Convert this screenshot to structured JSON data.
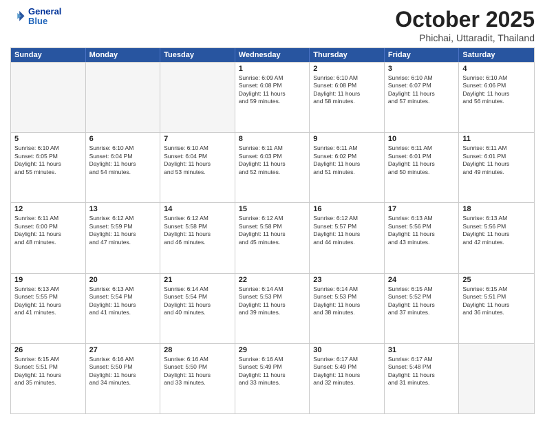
{
  "logo": {
    "line1": "General",
    "line2": "Blue"
  },
  "title": "October 2025",
  "subtitle": "Phichai, Uttaradit, Thailand",
  "header_days": [
    "Sunday",
    "Monday",
    "Tuesday",
    "Wednesday",
    "Thursday",
    "Friday",
    "Saturday"
  ],
  "weeks": [
    [
      {
        "day": "",
        "info": ""
      },
      {
        "day": "",
        "info": ""
      },
      {
        "day": "",
        "info": ""
      },
      {
        "day": "1",
        "info": "Sunrise: 6:09 AM\nSunset: 6:08 PM\nDaylight: 11 hours\nand 59 minutes."
      },
      {
        "day": "2",
        "info": "Sunrise: 6:10 AM\nSunset: 6:08 PM\nDaylight: 11 hours\nand 58 minutes."
      },
      {
        "day": "3",
        "info": "Sunrise: 6:10 AM\nSunset: 6:07 PM\nDaylight: 11 hours\nand 57 minutes."
      },
      {
        "day": "4",
        "info": "Sunrise: 6:10 AM\nSunset: 6:06 PM\nDaylight: 11 hours\nand 56 minutes."
      }
    ],
    [
      {
        "day": "5",
        "info": "Sunrise: 6:10 AM\nSunset: 6:05 PM\nDaylight: 11 hours\nand 55 minutes."
      },
      {
        "day": "6",
        "info": "Sunrise: 6:10 AM\nSunset: 6:04 PM\nDaylight: 11 hours\nand 54 minutes."
      },
      {
        "day": "7",
        "info": "Sunrise: 6:10 AM\nSunset: 6:04 PM\nDaylight: 11 hours\nand 53 minutes."
      },
      {
        "day": "8",
        "info": "Sunrise: 6:11 AM\nSunset: 6:03 PM\nDaylight: 11 hours\nand 52 minutes."
      },
      {
        "day": "9",
        "info": "Sunrise: 6:11 AM\nSunset: 6:02 PM\nDaylight: 11 hours\nand 51 minutes."
      },
      {
        "day": "10",
        "info": "Sunrise: 6:11 AM\nSunset: 6:01 PM\nDaylight: 11 hours\nand 50 minutes."
      },
      {
        "day": "11",
        "info": "Sunrise: 6:11 AM\nSunset: 6:01 PM\nDaylight: 11 hours\nand 49 minutes."
      }
    ],
    [
      {
        "day": "12",
        "info": "Sunrise: 6:11 AM\nSunset: 6:00 PM\nDaylight: 11 hours\nand 48 minutes."
      },
      {
        "day": "13",
        "info": "Sunrise: 6:12 AM\nSunset: 5:59 PM\nDaylight: 11 hours\nand 47 minutes."
      },
      {
        "day": "14",
        "info": "Sunrise: 6:12 AM\nSunset: 5:58 PM\nDaylight: 11 hours\nand 46 minutes."
      },
      {
        "day": "15",
        "info": "Sunrise: 6:12 AM\nSunset: 5:58 PM\nDaylight: 11 hours\nand 45 minutes."
      },
      {
        "day": "16",
        "info": "Sunrise: 6:12 AM\nSunset: 5:57 PM\nDaylight: 11 hours\nand 44 minutes."
      },
      {
        "day": "17",
        "info": "Sunrise: 6:13 AM\nSunset: 5:56 PM\nDaylight: 11 hours\nand 43 minutes."
      },
      {
        "day": "18",
        "info": "Sunrise: 6:13 AM\nSunset: 5:56 PM\nDaylight: 11 hours\nand 42 minutes."
      }
    ],
    [
      {
        "day": "19",
        "info": "Sunrise: 6:13 AM\nSunset: 5:55 PM\nDaylight: 11 hours\nand 41 minutes."
      },
      {
        "day": "20",
        "info": "Sunrise: 6:13 AM\nSunset: 5:54 PM\nDaylight: 11 hours\nand 41 minutes."
      },
      {
        "day": "21",
        "info": "Sunrise: 6:14 AM\nSunset: 5:54 PM\nDaylight: 11 hours\nand 40 minutes."
      },
      {
        "day": "22",
        "info": "Sunrise: 6:14 AM\nSunset: 5:53 PM\nDaylight: 11 hours\nand 39 minutes."
      },
      {
        "day": "23",
        "info": "Sunrise: 6:14 AM\nSunset: 5:53 PM\nDaylight: 11 hours\nand 38 minutes."
      },
      {
        "day": "24",
        "info": "Sunrise: 6:15 AM\nSunset: 5:52 PM\nDaylight: 11 hours\nand 37 minutes."
      },
      {
        "day": "25",
        "info": "Sunrise: 6:15 AM\nSunset: 5:51 PM\nDaylight: 11 hours\nand 36 minutes."
      }
    ],
    [
      {
        "day": "26",
        "info": "Sunrise: 6:15 AM\nSunset: 5:51 PM\nDaylight: 11 hours\nand 35 minutes."
      },
      {
        "day": "27",
        "info": "Sunrise: 6:16 AM\nSunset: 5:50 PM\nDaylight: 11 hours\nand 34 minutes."
      },
      {
        "day": "28",
        "info": "Sunrise: 6:16 AM\nSunset: 5:50 PM\nDaylight: 11 hours\nand 33 minutes."
      },
      {
        "day": "29",
        "info": "Sunrise: 6:16 AM\nSunset: 5:49 PM\nDaylight: 11 hours\nand 33 minutes."
      },
      {
        "day": "30",
        "info": "Sunrise: 6:17 AM\nSunset: 5:49 PM\nDaylight: 11 hours\nand 32 minutes."
      },
      {
        "day": "31",
        "info": "Sunrise: 6:17 AM\nSunset: 5:48 PM\nDaylight: 11 hours\nand 31 minutes."
      },
      {
        "day": "",
        "info": ""
      }
    ]
  ]
}
